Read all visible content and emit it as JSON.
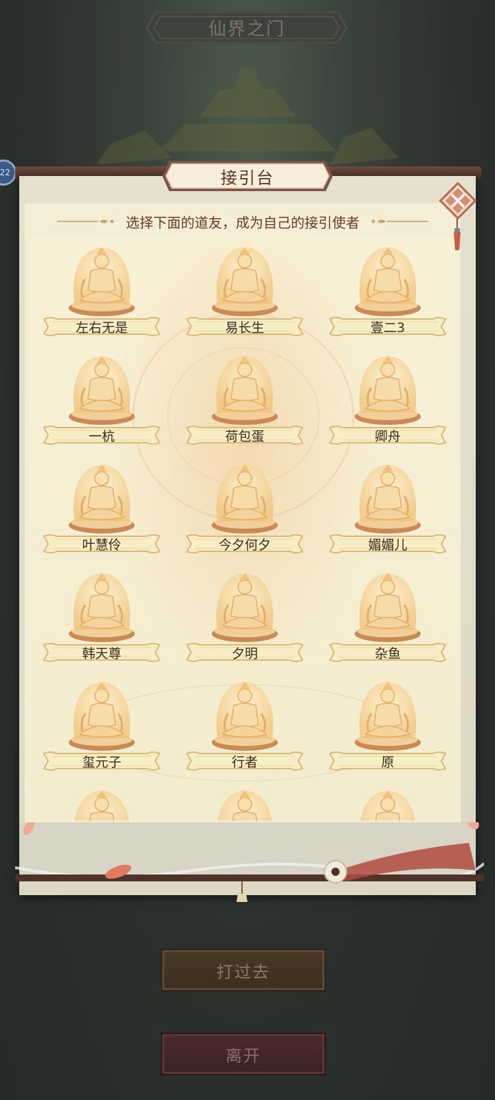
{
  "header": {
    "title": "仙界之门",
    "level": "22"
  },
  "panel": {
    "title": "接引台",
    "subtitle": "选择下面的道友，成为自己的接引使者"
  },
  "players": [
    {
      "name": "左右无是"
    },
    {
      "name": "易长生"
    },
    {
      "name": "壹二3"
    },
    {
      "name": "一杭"
    },
    {
      "name": "荷包蛋"
    },
    {
      "name": "卿舟"
    },
    {
      "name": "叶慧伶"
    },
    {
      "name": "今夕何夕"
    },
    {
      "name": "媚媚儿"
    },
    {
      "name": "韩天尊"
    },
    {
      "name": "夕明"
    },
    {
      "name": "杂鱼"
    },
    {
      "name": "玺元子"
    },
    {
      "name": "行者"
    },
    {
      "name": "原"
    }
  ],
  "buttons": {
    "fight": "打过去",
    "leave": "离开"
  },
  "colors": {
    "gold": "#e8b45a",
    "plate": "#f6edc2",
    "title_text": "#5a3324"
  },
  "icons": {
    "close": "close-x-icon",
    "statue": "golden-cultivator-statue"
  }
}
